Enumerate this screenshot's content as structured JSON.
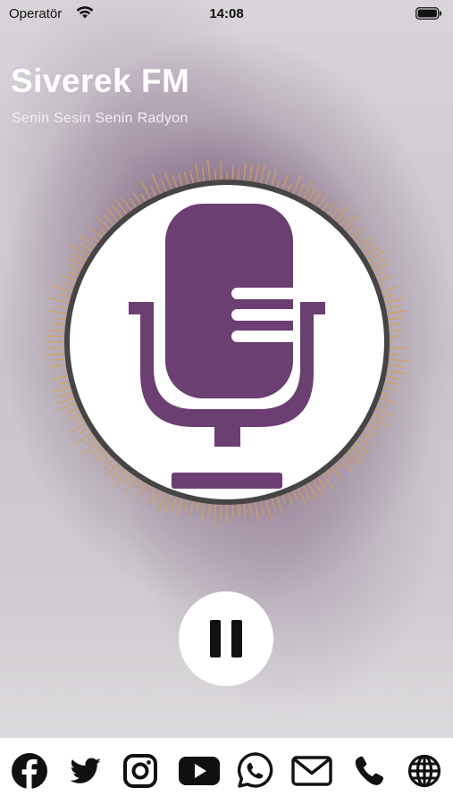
{
  "status_bar": {
    "carrier": "Operatör",
    "time": "14:08"
  },
  "station": {
    "name": "Siverek FM",
    "slogan": "Senin Sesin Senin Radyon"
  },
  "colors": {
    "accent": "#6b3f72",
    "visualizer": "#d9a24a",
    "ring": "#4a4a4a",
    "icon": "#111111"
  },
  "player": {
    "state": "playing",
    "control_icon": "pause-icon"
  },
  "footer": {
    "icons": [
      "facebook-icon",
      "twitter-icon",
      "instagram-icon",
      "youtube-icon",
      "whatsapp-icon",
      "mail-icon",
      "phone-icon",
      "globe-icon"
    ]
  }
}
